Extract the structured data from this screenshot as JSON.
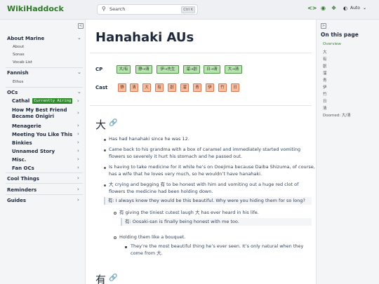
{
  "header": {
    "site_title": "WikiHaddock",
    "search_placeholder": "Search",
    "search_shortcut": "Ctrl K",
    "theme_select": "Auto",
    "icons": [
      "code-icon",
      "mastodon-icon",
      "bluesky-icon",
      "contrast-icon"
    ]
  },
  "sidebar": {
    "sections": [
      {
        "label": "About Marine",
        "children": [
          "About",
          "Sonas",
          "Vocab List"
        ]
      },
      {
        "label": "Fannish",
        "children": [
          "Ethos"
        ]
      },
      {
        "label": "OCs",
        "children": []
      }
    ],
    "ocs": [
      {
        "label": "Cathal",
        "badge": "Currently Airing"
      },
      {
        "label": "How My Best Friend",
        "label2": "Became Onigiri"
      },
      {
        "label": "Menagerie"
      },
      {
        "label": "Meeting You Like This"
      },
      {
        "label": "Binkies"
      },
      {
        "label": "Unnamed Story"
      },
      {
        "label": "Misc."
      },
      {
        "label": "Fan OCs"
      }
    ],
    "bottom": [
      "Cool Things",
      "Reminders",
      "Guides"
    ]
  },
  "main": {
    "title": "Hanahaki AUs",
    "cp_label": "CP",
    "cp_tags": [
      "大/有",
      "静→清",
      "伊→先生",
      "溜→創",
      "日→清",
      "大→清"
    ],
    "cast_label": "Cast",
    "cast_tags": [
      "静",
      "清",
      "大",
      "有",
      "創",
      "溜",
      "青",
      "伊",
      "竹",
      "日"
    ],
    "section1_title": "大",
    "section2_title": "有",
    "bullets": [
      "Has had hanahaki since he was 12.",
      "Came back to his grandma with a box of caramel and immediately started vomiting",
      "flowers so severely it hurt his stomach and he passed out.",
      "Is having to take medicine for it while he’s on Ooejima because Daiba Shizuma, of course,",
      "has a wife that he loves very much, so he wouldn’t have hanahaki.",
      "大 crying and begging 有 to be honest with him and vomiting out a huge red clot of",
      "flowers the medicine had been holding down."
    ],
    "quote1": "有: I always knew they would be this beautiful. Why were you hiding them for so long?",
    "sub_bullet1": "有 giving the tiniest cutest laugh 大 has ever heard in his life.",
    "quote2": "有: Oosaki-san is finally being honest with me too.",
    "sub_bullet2": "Holding them like a bouquet.",
    "subsub1": "They’re the most beautiful thing he’s ever seen. It’s only natural when they",
    "subsub2": "come from 大."
  },
  "toc": {
    "title": "On this page",
    "items": [
      "Overview",
      "大",
      "有",
      "創",
      "溜",
      "青",
      "伊",
      "竹",
      "日",
      "清",
      "Doomed: 大/清"
    ]
  }
}
